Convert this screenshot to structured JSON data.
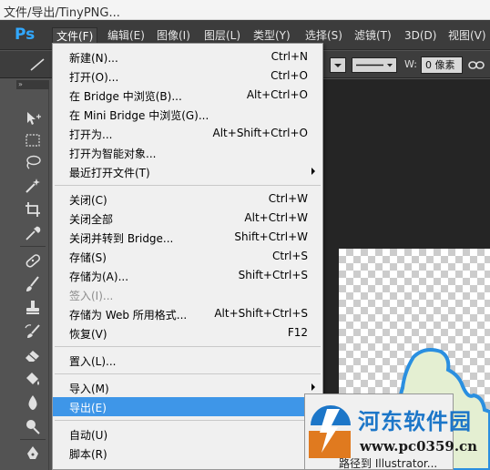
{
  "window": {
    "title": "文件/导出/TinyPNG..."
  },
  "app": {
    "logo": "Ps"
  },
  "menubar": {
    "items": [
      {
        "label": "文件(F)"
      },
      {
        "label": "编辑(E)"
      },
      {
        "label": "图像(I)"
      },
      {
        "label": "图层(L)"
      },
      {
        "label": "类型(Y)"
      },
      {
        "label": "选择(S)"
      },
      {
        "label": "滤镜(T)"
      },
      {
        "label": "3D(D)"
      },
      {
        "label": "视图(V)"
      }
    ]
  },
  "options": {
    "width_label": "W:",
    "width_value": "0 像素"
  },
  "toolbox": {
    "collapse": "»"
  },
  "file_menu": {
    "items": [
      {
        "label": "新建(N)...",
        "shortcut": "Ctrl+N"
      },
      {
        "label": "打开(O)...",
        "shortcut": "Ctrl+O"
      },
      {
        "label": "在 Bridge 中浏览(B)...",
        "shortcut": "Alt+Ctrl+O"
      },
      {
        "label": "在 Mini Bridge 中浏览(G)...",
        "shortcut": ""
      },
      {
        "label": "打开为...",
        "shortcut": "Alt+Shift+Ctrl+O"
      },
      {
        "label": "打开为智能对象...",
        "shortcut": ""
      },
      {
        "label": "最近打开文件(T)",
        "shortcut": ""
      },
      {
        "label": "关闭(C)",
        "shortcut": "Ctrl+W"
      },
      {
        "label": "关闭全部",
        "shortcut": "Alt+Ctrl+W"
      },
      {
        "label": "关闭并转到 Bridge...",
        "shortcut": "Shift+Ctrl+W"
      },
      {
        "label": "存储(S)",
        "shortcut": "Ctrl+S"
      },
      {
        "label": "存储为(A)...",
        "shortcut": "Shift+Ctrl+S"
      },
      {
        "label": "签入(I)...",
        "shortcut": ""
      },
      {
        "label": "存储为 Web 所用格式...",
        "shortcut": "Alt+Shift+Ctrl+S"
      },
      {
        "label": "恢复(V)",
        "shortcut": "F12"
      },
      {
        "label": "置入(L)...",
        "shortcut": ""
      },
      {
        "label": "导入(M)",
        "shortcut": ""
      },
      {
        "label": "导出(E)",
        "shortcut": ""
      },
      {
        "label": "自动(U)",
        "shortcut": ""
      },
      {
        "label": "脚本(R)",
        "shortcut": ""
      }
    ]
  },
  "submenu": {
    "partial_text": "路径到 Illustrator..."
  },
  "watermark": {
    "title": "河东软件园",
    "url": "www.pc0359.cn"
  },
  "colors": {
    "highlight": "#3e96e8",
    "ps_blue": "#31a8ff",
    "watermark_blue": "#1c76c8"
  }
}
